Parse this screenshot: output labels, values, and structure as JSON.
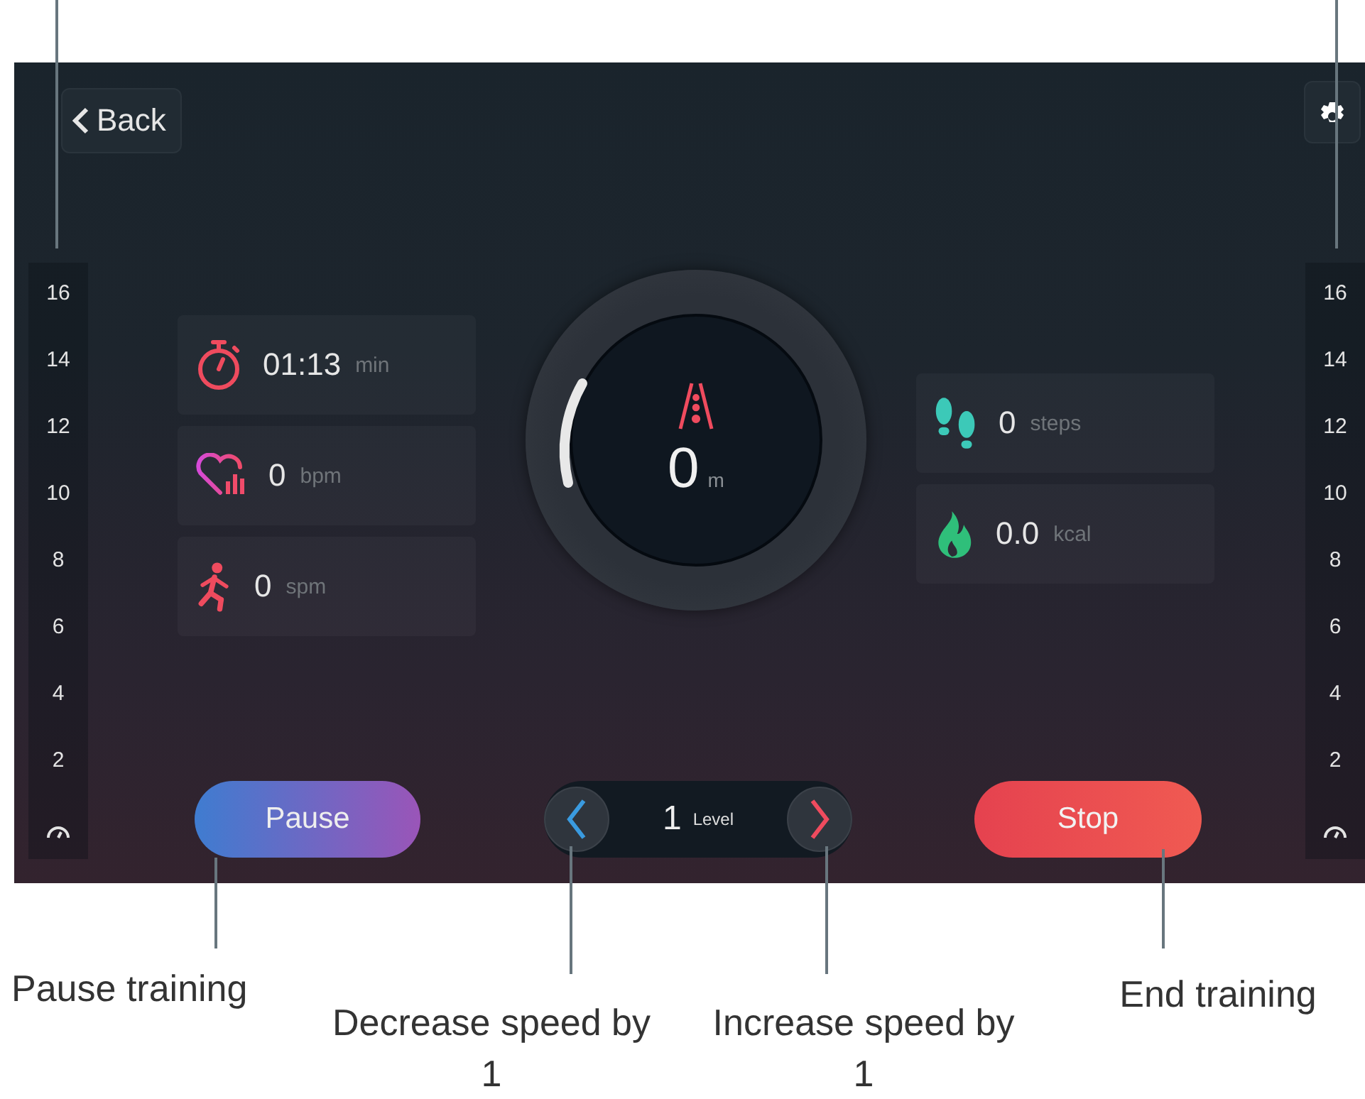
{
  "top_bar": {
    "back_label": "Back"
  },
  "speed_scale_left": {
    "ticks": [
      "16",
      "14",
      "12",
      "10",
      "8",
      "6",
      "4",
      "2"
    ]
  },
  "speed_scale_right": {
    "ticks": [
      "16",
      "14",
      "12",
      "10",
      "8",
      "6",
      "4",
      "2"
    ]
  },
  "metrics_left": [
    {
      "kind": "time",
      "value": "01:13",
      "unit": "min"
    },
    {
      "kind": "heart_rate",
      "value": "0",
      "unit": "bpm"
    },
    {
      "kind": "cadence",
      "value": "0",
      "unit": "spm"
    }
  ],
  "distance": {
    "value": "0",
    "unit": "m"
  },
  "metrics_right": [
    {
      "kind": "steps",
      "value": "0",
      "unit": "steps"
    },
    {
      "kind": "calories",
      "value": "0.0",
      "unit": "kcal"
    }
  ],
  "controls": {
    "pause": "Pause",
    "level_value": "1",
    "level_label": "Level",
    "stop": "Stop"
  },
  "annotations": [
    {
      "kind": "pause",
      "text": "Pause training"
    },
    {
      "kind": "decrease",
      "text": "Decrease speed by 1"
    },
    {
      "kind": "increase",
      "text": "Increase speed by 1"
    },
    {
      "kind": "stop",
      "text": "End training"
    }
  ]
}
